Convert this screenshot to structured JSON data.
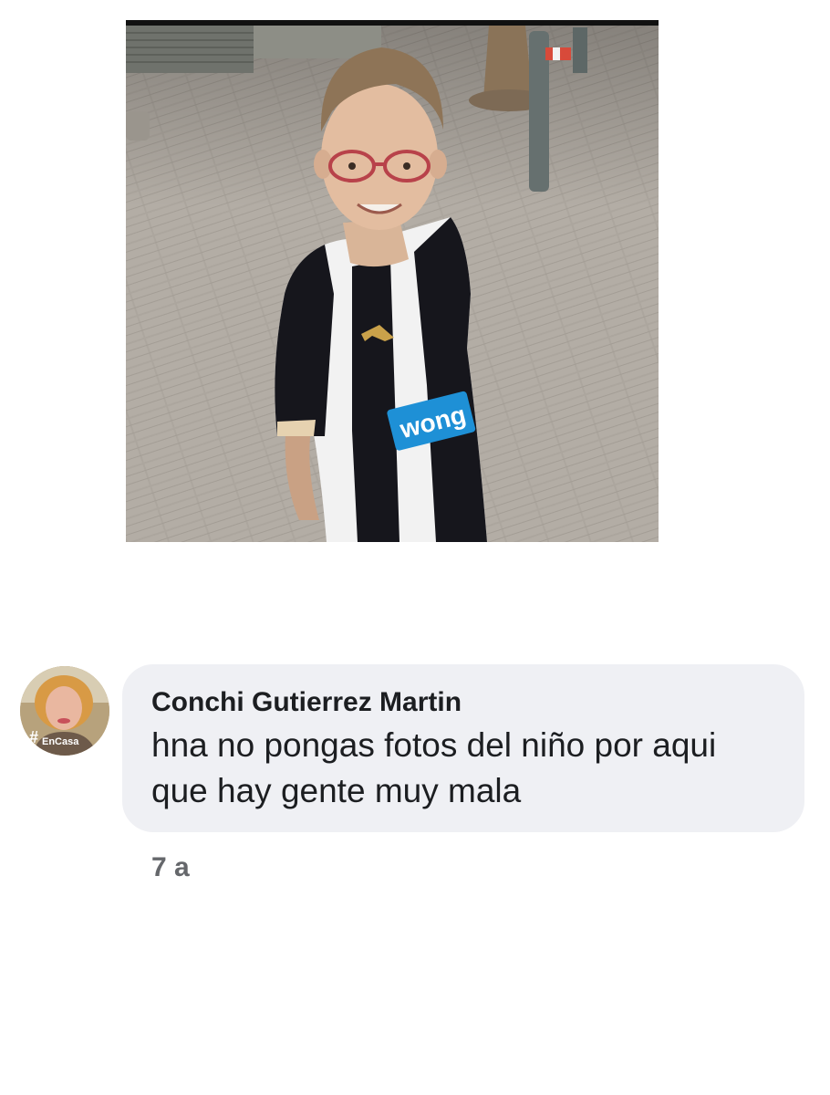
{
  "post": {
    "photo_alt": "",
    "jersey_sponsor": "wong"
  },
  "comment": {
    "author": "Conchi Gutierrez Martin",
    "text": "hna no pongas fotos del niño por aqui que hay gente muy mala",
    "timestamp": "7 a",
    "avatar_badge_hash": "#",
    "avatar_badge_text": "EnCasa"
  },
  "colors": {
    "bubble": "#eff0f4",
    "text": "#1c1e21",
    "muted": "#65676b",
    "sponsor_blue": "#1e90d6"
  }
}
